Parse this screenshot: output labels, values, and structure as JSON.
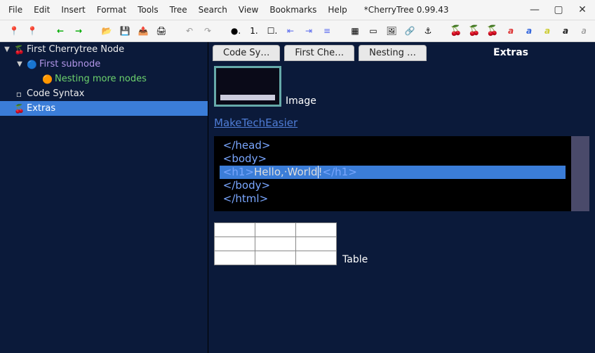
{
  "menu": {
    "items": [
      "File",
      "Edit",
      "Insert",
      "Format",
      "Tools",
      "Tree",
      "Search",
      "View",
      "Bookmarks",
      "Help"
    ]
  },
  "window": {
    "title": "*CherryTree 0.99.43"
  },
  "toolbar": {
    "ordinal": "1."
  },
  "tree": {
    "nodes": [
      {
        "label": "First Cherrytree Node",
        "depth": 0,
        "color": "white",
        "expander": "▼",
        "icon": "🍒"
      },
      {
        "label": "First subnode",
        "depth": 1,
        "color": "purple",
        "expander": "▼",
        "icon": "🔵"
      },
      {
        "label": "Nesting more nodes",
        "depth": 2,
        "color": "green",
        "expander": "",
        "icon": "🟠"
      },
      {
        "label": "Code Syntax",
        "depth": 0,
        "color": "white",
        "expander": "",
        "icon": "▫"
      },
      {
        "label": "Extras",
        "depth": 0,
        "color": "white",
        "expander": "",
        "icon": "🍒",
        "selected": true
      }
    ]
  },
  "tabs": {
    "items": [
      {
        "label": "Code Sy…"
      },
      {
        "label": "First Che…"
      },
      {
        "label": "Nesting …"
      }
    ],
    "title": "Extras"
  },
  "content": {
    "image_label": "Image",
    "link_text": "MakeTechEasier",
    "code_lines": [
      {
        "pre": " </",
        "tag": "head",
        "post": ">"
      },
      {
        "pre": " <",
        "tag": "body",
        "post": ">"
      },
      {
        "selected": true,
        "pre": " <",
        "tag": "h1",
        "post": ">",
        "text": "Hello,·World",
        "text2": "!",
        "close_pre": "</",
        "close_tag": "h1",
        "close_post": ">"
      },
      {
        "pre": " </",
        "tag": "body",
        "post": ">"
      },
      {
        "pre": " </",
        "tag": "html",
        "post": ">"
      }
    ],
    "table_label": "Table"
  }
}
